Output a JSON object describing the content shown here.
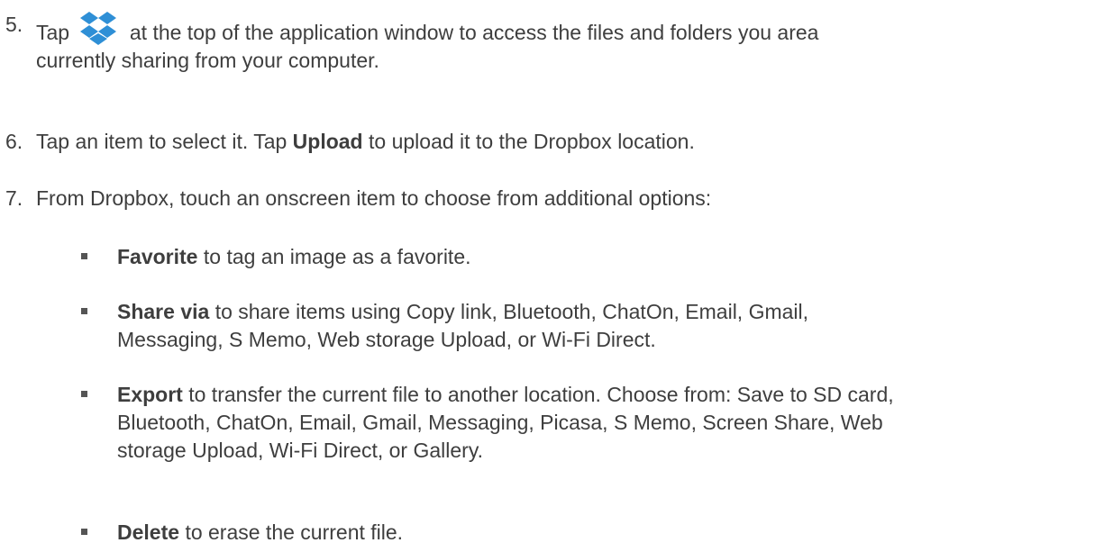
{
  "steps": [
    {
      "number": "5.",
      "before_icon": "Tap",
      "icon": "dropbox-icon",
      "after_icon": "at the top of the application window to access the files and folders you area",
      "line2": "currently sharing from your computer."
    },
    {
      "number": "6.",
      "t1": "Tap an item to select it. Tap",
      "bold": "Upload",
      "t2": "to upload it to the Dropbox location."
    },
    {
      "number": "7.",
      "text": "From Dropbox, touch an onscreen item to choose from additional options:"
    }
  ],
  "options": [
    {
      "term": "Favorite",
      "desc": "to tag an image as a favorite."
    },
    {
      "term": "Share via",
      "desc": "to share items using Copy link, Bluetooth, ChatOn, Email, Gmail,",
      "desc2": "Messaging, S Memo, Web storage Upload, or Wi-Fi Direct."
    },
    {
      "term": "Export",
      "desc": "to transfer the current file to another location. Choose from: Save to SD card,",
      "desc2": "Bluetooth, ChatOn, Email, Gmail, Messaging, Picasa, S Memo, Screen Share, Web",
      "desc3": "storage Upload, Wi-Fi Direct, or Gallery."
    },
    {
      "term": "Delete",
      "desc": "to erase the current file."
    }
  ],
  "colors": {
    "text": "#3e3e3e",
    "icon": "#2e8fd6"
  }
}
